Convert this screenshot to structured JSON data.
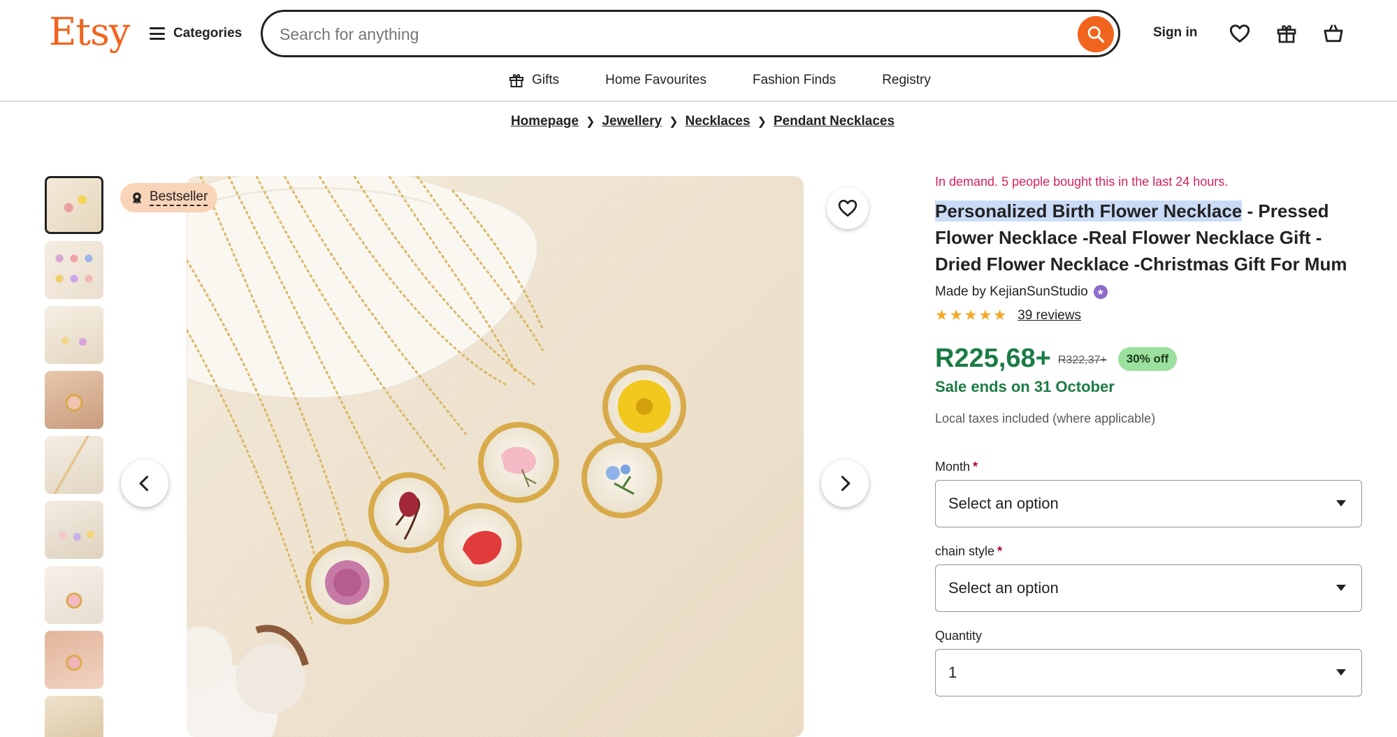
{
  "header": {
    "logo": "Etsy",
    "categories_label": "Categories",
    "search_placeholder": "Search for anything",
    "signin_label": "Sign in",
    "icons": [
      "heart-icon",
      "gift-icon",
      "basket-icon"
    ]
  },
  "subnav": {
    "items": [
      {
        "label": "Gifts",
        "icon": "gift-icon"
      },
      {
        "label": "Home Favourites"
      },
      {
        "label": "Fashion Finds"
      },
      {
        "label": "Registry"
      }
    ]
  },
  "breadcrumb": [
    "Homepage",
    "Jewellery",
    "Necklaces",
    "Pendant Necklaces"
  ],
  "gallery": {
    "badge": "Bestseller",
    "thumbnail_count": 9,
    "active_thumbnail": 1
  },
  "product": {
    "demand_text": "In demand. 5 people bought this in the last 24 hours.",
    "title_highlight": "Personalized Birth Flower Necklace",
    "title_rest": " - Pressed Flower Necklace -Real Flower Necklace Gift -Dried Flower Necklace -Christmas Gift For Mum",
    "made_by": "Made by KejianSunStudio",
    "rating": 5,
    "reviews_label": "39 reviews",
    "price": "R225,68+",
    "original_price": "R322,37+",
    "discount": "30% off",
    "sale_ends": "Sale ends on 31 October",
    "taxes_note": "Local taxes included (where applicable)"
  },
  "options": {
    "month": {
      "label": "Month",
      "value": "Select an option"
    },
    "chain_style": {
      "label": "chain style",
      "value": "Select an option"
    },
    "quantity": {
      "label": "Quantity",
      "value": "1"
    }
  },
  "colors": {
    "brand": "#f1641e",
    "price_green": "#1b7b45",
    "demand_red": "#d5215c",
    "discount_bg": "#9be09e",
    "bestseller_bg": "#fad4b8"
  }
}
